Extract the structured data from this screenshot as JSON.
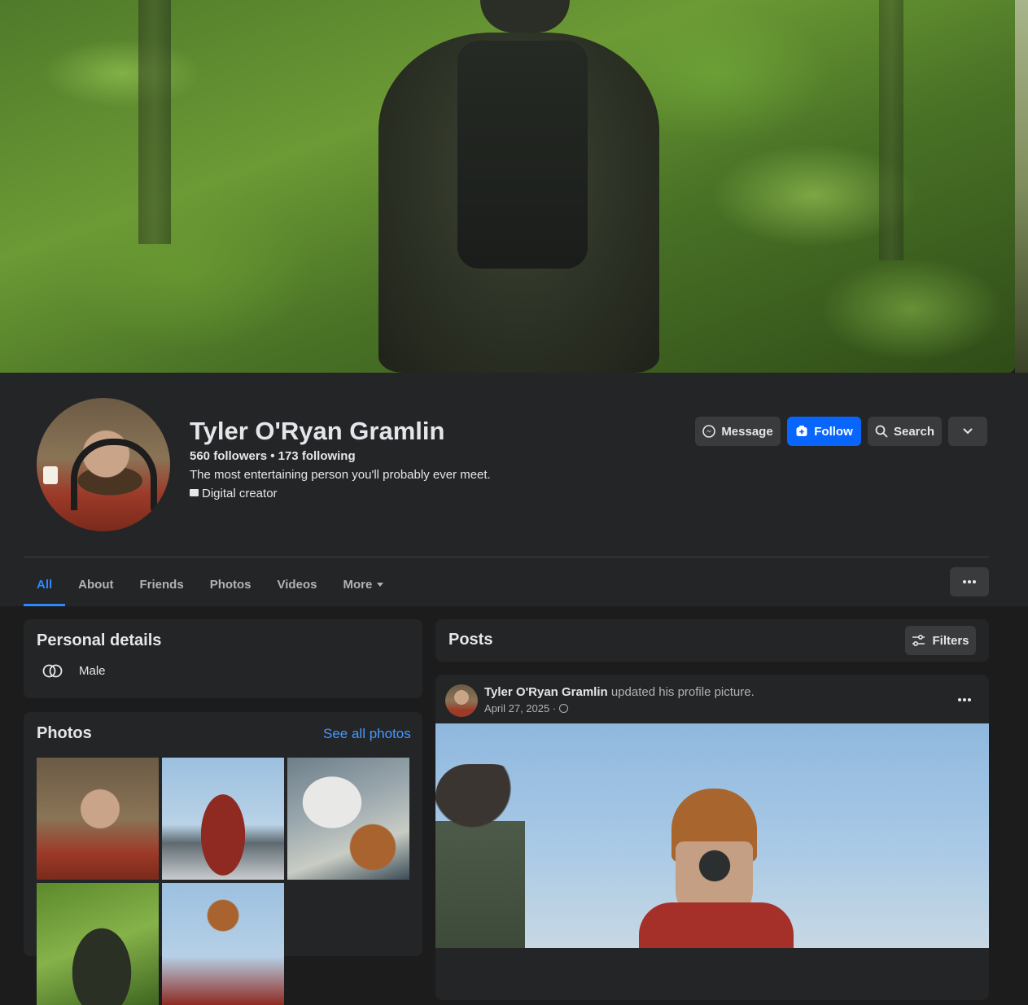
{
  "profile": {
    "name": "Tyler O'Ryan Gramlin",
    "followers_line": "560 followers • 173 following",
    "bio": "The most entertaining person you'll probably ever meet.",
    "category": "Digital creator"
  },
  "actions": {
    "message": "Message",
    "follow": "Follow",
    "search": "Search"
  },
  "tabs": [
    "All",
    "About",
    "Friends",
    "Photos",
    "Videos",
    "More"
  ],
  "personal_details": {
    "title": "Personal details",
    "gender": "Male"
  },
  "photos": {
    "title": "Photos",
    "see_all": "See all photos"
  },
  "posts": {
    "title": "Posts",
    "filters": "Filters",
    "post": {
      "author": "Tyler O'Ryan Gramlin",
      "action": " updated his profile picture.",
      "date": "April 27, 2025 ·"
    }
  },
  "colors": {
    "accent": "#0866ff",
    "link": "#4599ff",
    "background": "#1c1c1d",
    "surface": "#242526"
  }
}
